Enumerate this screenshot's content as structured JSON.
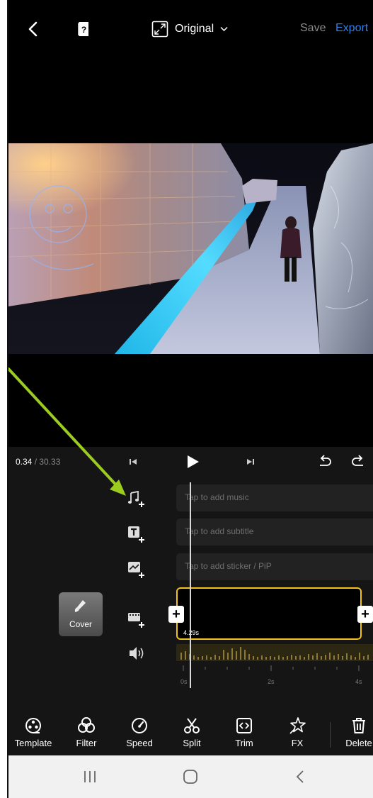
{
  "topbar": {
    "aspect_label": "Original",
    "save_label": "Save",
    "export_label": "Export",
    "export_color": "#2f7ee8"
  },
  "editor": {
    "current_time": "0.34",
    "total_time": "/ 30.33",
    "tracks": {
      "music_hint": "Tap to add music",
      "subtitle_hint": "Tap to add subtitle",
      "sticker_hint": "Tap to add sticker / PiP"
    },
    "cover_label": "Cover",
    "clip_duration": "4.29s",
    "ruler_labels": [
      "0s",
      "2s",
      "4s"
    ],
    "clip_border_color": "#f3c31a"
  },
  "toolbar": {
    "items": [
      {
        "label": "Template",
        "icon": "film-reel-icon"
      },
      {
        "label": "Filter",
        "icon": "filter-icon"
      },
      {
        "label": "Speed",
        "icon": "speedometer-icon"
      },
      {
        "label": "Split",
        "icon": "scissors-icon"
      },
      {
        "label": "Trim",
        "icon": "trim-icon"
      },
      {
        "label": "FX",
        "icon": "fx-star-icon"
      },
      {
        "label": "Delete",
        "icon": "trash-icon"
      }
    ]
  },
  "annotation": {
    "color": "#9ccc1f"
  }
}
